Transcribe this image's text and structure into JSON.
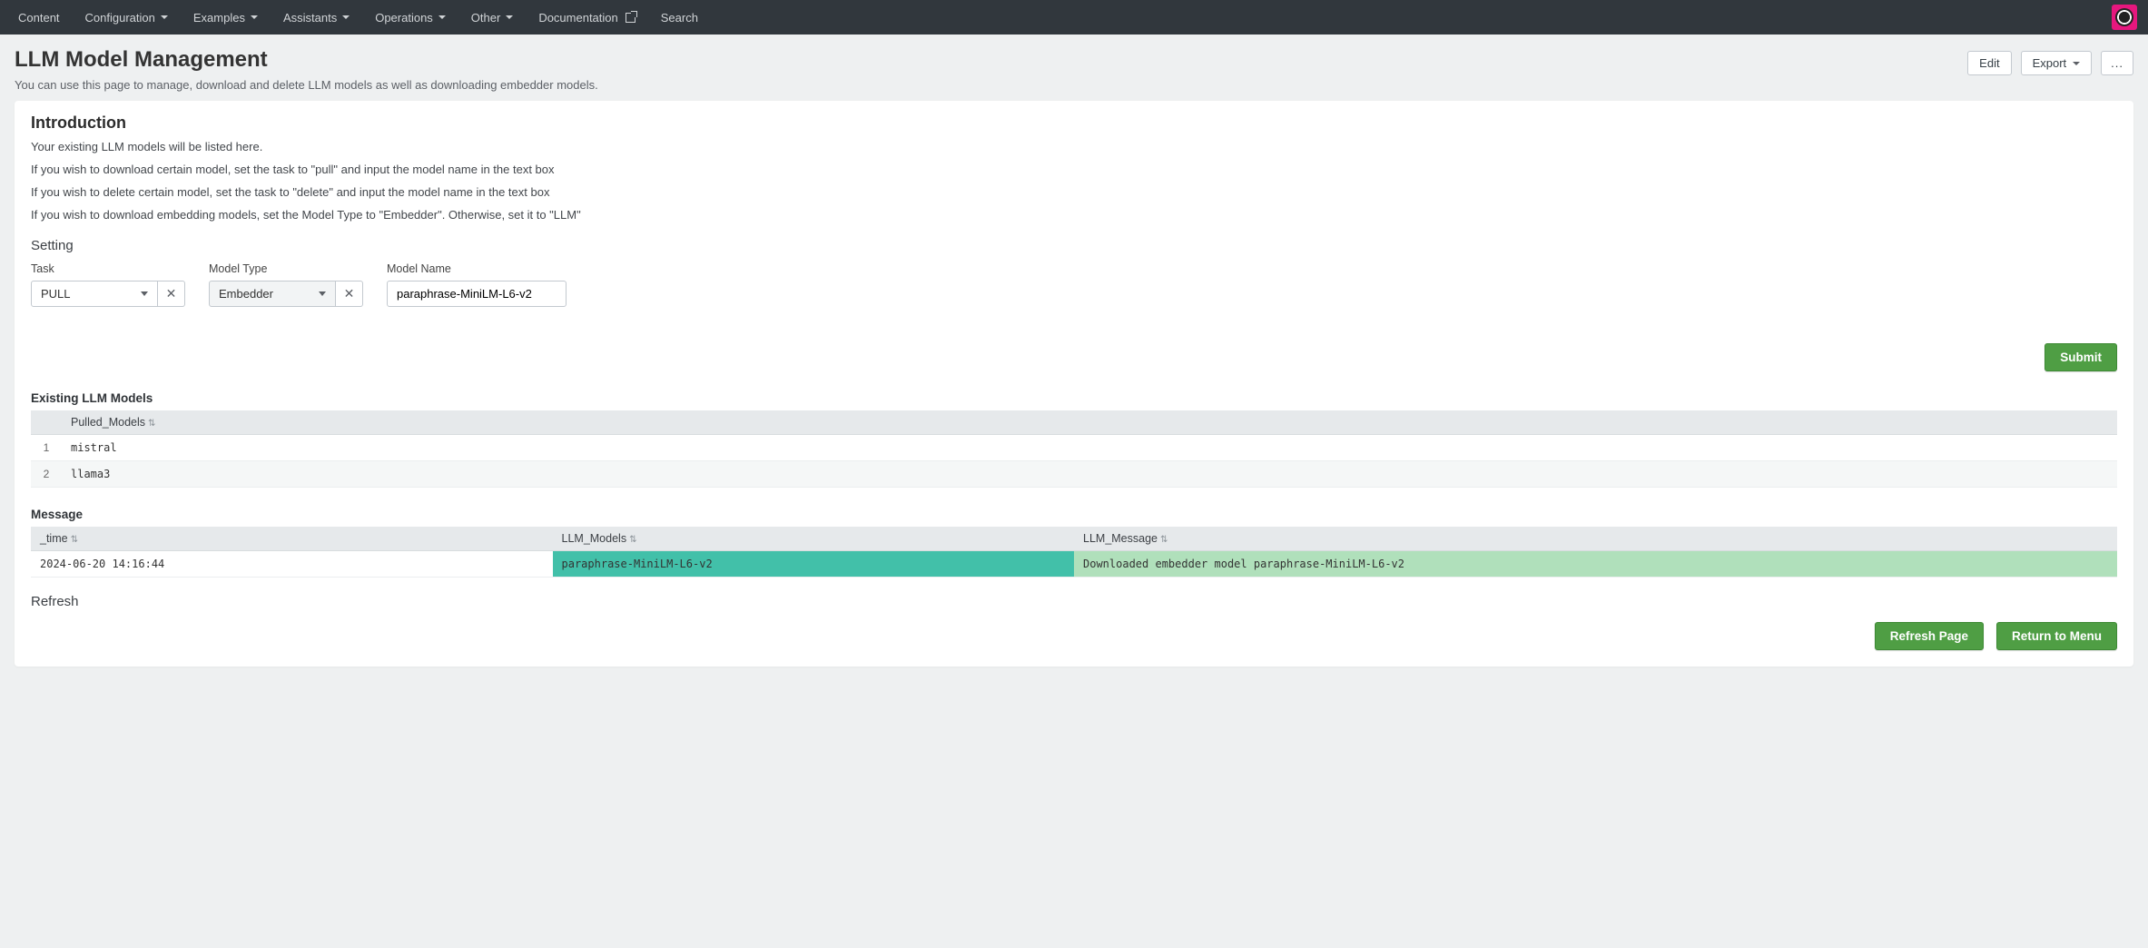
{
  "nav": {
    "items": [
      {
        "label": "Content",
        "dropdown": false
      },
      {
        "label": "Configuration",
        "dropdown": true
      },
      {
        "label": "Examples",
        "dropdown": true
      },
      {
        "label": "Assistants",
        "dropdown": true
      },
      {
        "label": "Operations",
        "dropdown": true
      },
      {
        "label": "Other",
        "dropdown": true
      },
      {
        "label": "Documentation",
        "dropdown": false,
        "external": true
      },
      {
        "label": "Search",
        "dropdown": false
      }
    ]
  },
  "header": {
    "title": "LLM Model Management",
    "description": "You can use this page to manage, download and delete LLM models as well as downloading embedder models.",
    "edit_label": "Edit",
    "export_label": "Export",
    "more_label": "..."
  },
  "intro": {
    "heading": "Introduction",
    "lines": [
      "Your existing LLM models will be listed here.",
      "If you wish to download certain model, set the task to \"pull\" and input the model name in the text box",
      "If you wish to delete certain model, set the task to \"delete\" and input the model name in the text box",
      "If you wish to download embedding models, set the Model Type to \"Embedder\". Otherwise, set it to \"LLM\""
    ]
  },
  "setting": {
    "heading": "Setting",
    "task_label": "Task",
    "task_value": "PULL",
    "modeltype_label": "Model Type",
    "modeltype_value": "Embedder",
    "modelname_label": "Model Name",
    "modelname_value": "paraphrase-MiniLM-L6-v2",
    "submit_label": "Submit"
  },
  "existing": {
    "heading": "Existing LLM Models",
    "col_header": "Pulled_Models",
    "rows": [
      {
        "idx": "1",
        "name": "mistral"
      },
      {
        "idx": "2",
        "name": "llama3"
      }
    ]
  },
  "message": {
    "heading": "Message",
    "col_time": "_time",
    "col_models": "LLM_Models",
    "col_msg": "LLM_Message",
    "rows": [
      {
        "time": "2024-06-20 14:16:44",
        "models": "paraphrase-MiniLM-L6-v2",
        "msg": "Downloaded embedder model paraphrase-MiniLM-L6-v2"
      }
    ]
  },
  "refresh": {
    "heading": "Refresh",
    "refresh_label": "Refresh Page",
    "return_label": "Return to Menu"
  }
}
